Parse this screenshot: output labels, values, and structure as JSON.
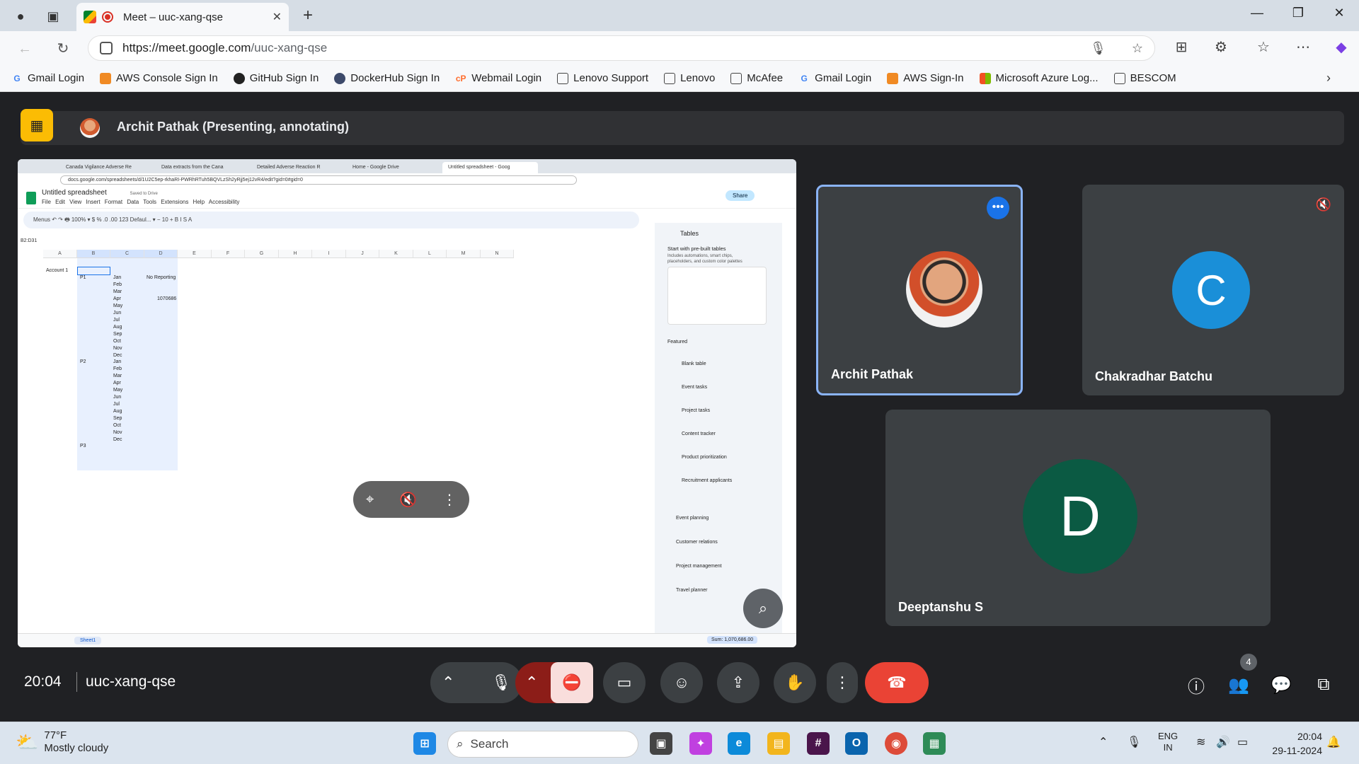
{
  "browser": {
    "tab_title": "Meet – uuc-xang-qse",
    "url_host": "https://meet.google.com",
    "url_path": "/uuc-xang-qse"
  },
  "bookmarks": [
    {
      "label": "Gmail Login",
      "icon": "google-icon"
    },
    {
      "label": "AWS Console Sign In",
      "icon": "aws-icon"
    },
    {
      "label": "GitHub Sign In",
      "icon": "github-icon"
    },
    {
      "label": "DockerHub Sign In",
      "icon": "docker-icon"
    },
    {
      "label": "Webmail Login",
      "icon": "cpanel-icon"
    },
    {
      "label": "Lenovo Support",
      "icon": "page-icon"
    },
    {
      "label": "Lenovo",
      "icon": "page-icon"
    },
    {
      "label": "McAfee",
      "icon": "page-icon"
    },
    {
      "label": "Gmail Login",
      "icon": "google-icon"
    },
    {
      "label": "AWS Sign-In",
      "icon": "aws-icon"
    },
    {
      "label": "Microsoft Azure Log...",
      "icon": "microsoft-icon"
    },
    {
      "label": "BESCOM",
      "icon": "page-icon"
    }
  ],
  "meet": {
    "presenter_label": "Archit Pathak (Presenting, annotating)",
    "time": "20:04",
    "meeting_code": "uuc-xang-qse",
    "participant_count": "4",
    "participants": [
      {
        "name": "Archit Pathak",
        "initial": "",
        "color": "#3c4043"
      },
      {
        "name": "Chakradhar Batchu",
        "initial": "C",
        "color": "#1a8fd8"
      },
      {
        "name": "Deeptanshu S",
        "initial": "D",
        "color": "#0b5a43"
      }
    ]
  },
  "shared_screen": {
    "tabs": [
      "Canada Vigilance Adverse Re",
      "Data extracts from the Cana",
      "Detailed Adverse Reaction R",
      "Home - Google Drive",
      "Untitled spreadsheet - Goog"
    ],
    "url": "docs.google.com/spreadsheets/d/1U2C5ep-rkhaRI-PWRhRTuh5BQVLzSh2yRjj5ej12vR4/edit?gid=0#gid=0",
    "doc_title": "Untitled spreadsheet",
    "saved": "Saved to Drive",
    "menu": "File Edit View Insert Format Data Tools Extensions Help Accessibility",
    "share_label": "Share",
    "toolbar": "Menus   ↶ ↷ 🖶   100% ▾   $ % .0 .00 123   Defaul... ▾   − 10 +   B I S A",
    "name_box": "B2:D31",
    "columns": [
      "A",
      "B",
      "C",
      "D",
      "E",
      "F",
      "G",
      "H",
      "I",
      "J",
      "K",
      "L",
      "M",
      "N"
    ],
    "account": "Account 1",
    "no_reporting": "No Reporting",
    "value": "1070686",
    "p1": "P1",
    "p2": "P2",
    "p3": "P3",
    "months": [
      "Jan",
      "Feb",
      "Mar",
      "Apr",
      "May",
      "Jun",
      "Jul",
      "Aug",
      "Sep",
      "Oct",
      "Nov",
      "Dec"
    ],
    "sheet_tab": "Sheet1",
    "sum": "Sum: 1,070,686.00",
    "side_panel": {
      "title": "Tables",
      "intro": "Start with pre-built tables",
      "desc1": "Includes automations, smart chips,",
      "desc2": "placeholders, and custom color palettes",
      "featured": "Featured",
      "featured_items": [
        "Blank table",
        "Event tasks",
        "Project tasks",
        "Content tracker",
        "Product prioritization",
        "Recruitment applicants"
      ],
      "groups": [
        "Event planning",
        "Customer relations",
        "Project management",
        "Travel planner"
      ]
    }
  },
  "taskbar": {
    "temp": "77°F",
    "weather": "Mostly cloudy",
    "search": "Search",
    "lang1": "ENG",
    "lang2": "IN",
    "time": "20:04",
    "date": "29-11-2024"
  }
}
